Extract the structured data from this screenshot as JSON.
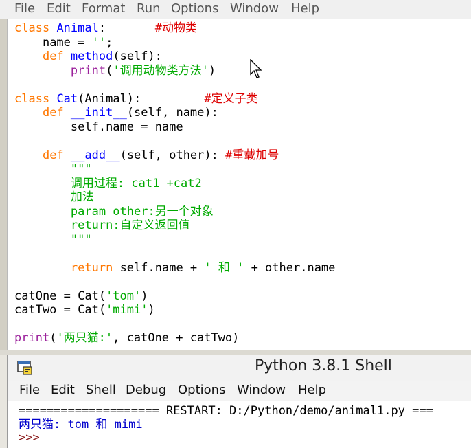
{
  "editor_menu": {
    "file": "File",
    "edit": "Edit",
    "format": "Format",
    "run": "Run",
    "options": "Options",
    "window": "Window",
    "help": "Help"
  },
  "code": {
    "l1_kw": "class",
    "l1_name": "Animal",
    "l1_colon": ":",
    "l1_comment": "#动物类",
    "l2": "name = ",
    "l2_str": "''",
    "l2_semi": ";",
    "l3_kw": "def",
    "l3_name": "method",
    "l3_rest": "(self):",
    "l4_fn": "print",
    "l4_open": "(",
    "l4_str": "'调用动物类方法'",
    "l4_close": ")",
    "l6_kw": "class",
    "l6_name": "Cat",
    "l6_rest": "(Animal):",
    "l6_comment": "#定义子类",
    "l7_kw": "def",
    "l7_name": "__init__",
    "l7_rest": "(self, name):",
    "l8": "self.name = name",
    "l10_kw": "def",
    "l10_name": "__add__",
    "l10_rest": "(self, other):",
    "l10_comment": "#重载加号",
    "doc1": "\"\"\"",
    "doc2": "调用过程: cat1 +cat2",
    "doc3": "加法",
    "doc4": "param other:另一个对象",
    "doc5": "return:自定义返回值",
    "doc6": "\"\"\"",
    "l17_kw": "return",
    "l17_a": "self.name + ",
    "l17_str": "' 和 '",
    "l17_b": " + other.name",
    "l19_a": "catOne = Cat(",
    "l19_str": "'tom'",
    "l19_b": ")",
    "l20_a": "catTwo = Cat(",
    "l20_str": "'mimi'",
    "l20_b": ")",
    "l22_fn": "print",
    "l22_open": "(",
    "l22_str": "'两只猫:'",
    "l22_b": ", catOne + catTwo)"
  },
  "shell": {
    "title": "Python 3.8.1 Shell",
    "menu": {
      "file": "File",
      "edit": "Edit",
      "shell": "Shell",
      "debug": "Debug",
      "options": "Options",
      "window": "Window",
      "help": "Help"
    },
    "restart_line": "==================== RESTART: D:/Python/demo/animal1.py ===",
    "output_line": "两只猫: tom 和 mimi",
    "prompt": ">>>"
  }
}
